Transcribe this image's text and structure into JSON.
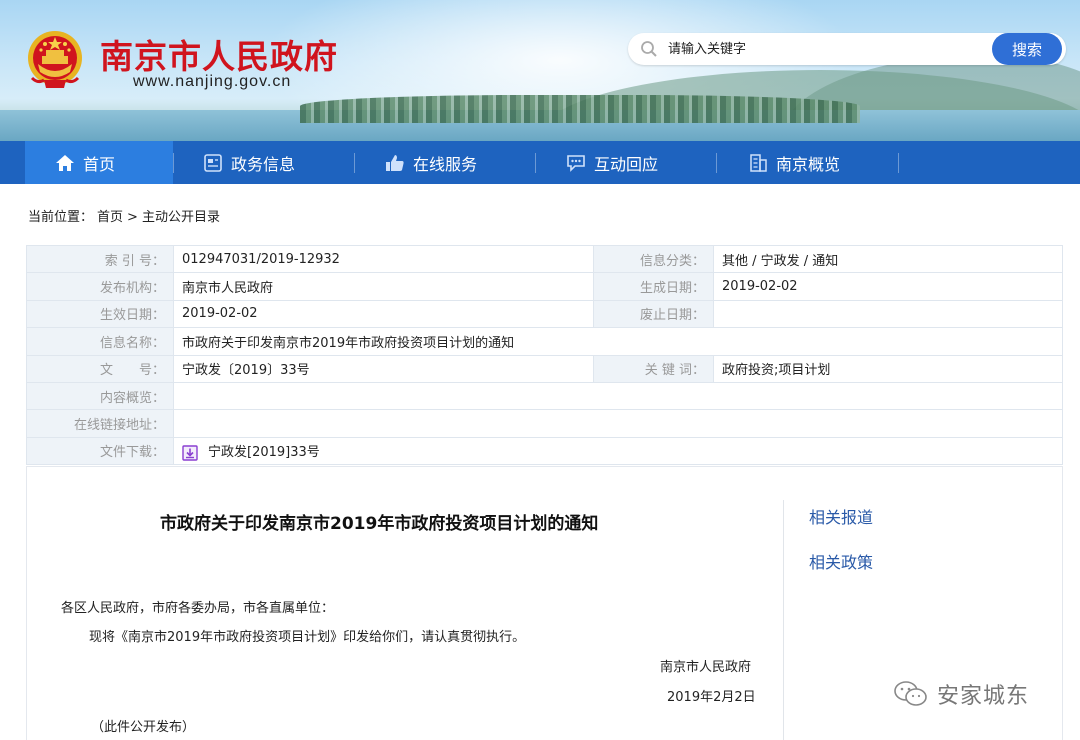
{
  "header": {
    "site_name": "南京市人民政府",
    "site_url": "www.nanjing.gov.cn",
    "search_placeholder": "请输入关键字",
    "search_button": "搜索"
  },
  "nav": {
    "items": [
      {
        "label": "首页",
        "icon": "home-icon",
        "active": true
      },
      {
        "label": "政务信息",
        "icon": "document-icon"
      },
      {
        "label": "在线服务",
        "icon": "thumbs-up-icon"
      },
      {
        "label": "互动回应",
        "icon": "chat-icon"
      },
      {
        "label": "南京概览",
        "icon": "building-icon"
      }
    ]
  },
  "breadcrumb": {
    "prefix": "当前位置：",
    "home": "首页",
    "separator": ">",
    "current": "主动公开目录"
  },
  "info": {
    "index_label": "索 引 号：",
    "index_value": "012947031/2019-12932",
    "category_label": "信息分类：",
    "category_value": "其他 / 宁政发 / 通知",
    "publisher_label": "发布机构：",
    "publisher_value": "南京市人民政府",
    "created_label": "生成日期：",
    "created_value": "2019-02-02",
    "effective_label": "生效日期：",
    "effective_value": "2019-02-02",
    "repeal_label": "废止日期：",
    "repeal_value": "",
    "name_label": "信息名称：",
    "name_value": "市政府关于印发南京市2019年市政府投资项目计划的通知",
    "docno_label": "文　　号：",
    "docno_value": "宁政发〔2019〕33号",
    "keywords_label": "关 键 词：",
    "keywords_value": "政府投资;项目计划",
    "summary_label": "内容概览：",
    "summary_value": "",
    "link_label": "在线链接地址：",
    "link_value": "",
    "download_label": "文件下载：",
    "download_value": "宁政发[2019]33号"
  },
  "article": {
    "title": "市政府关于印发南京市2019年市政府投资项目计划的通知",
    "salutation": "各区人民政府，市府各委办局，市各直属单位：",
    "body": "现将《南京市2019年市政府投资项目计划》印发给你们，请认真贯彻执行。",
    "signer": "南京市人民政府",
    "date": "2019年2月2日",
    "note": "（此件公开发布）"
  },
  "sidebar": {
    "related_news": "相关报道",
    "related_policy": "相关政策"
  },
  "watermark": {
    "text": "安家城东"
  },
  "colors": {
    "brand_red": "#d0141e",
    "nav_blue": "#1e63bf",
    "nav_active": "#2c7ee0",
    "search_button": "#2f6fd6",
    "link_blue": "#2a5aa8"
  }
}
